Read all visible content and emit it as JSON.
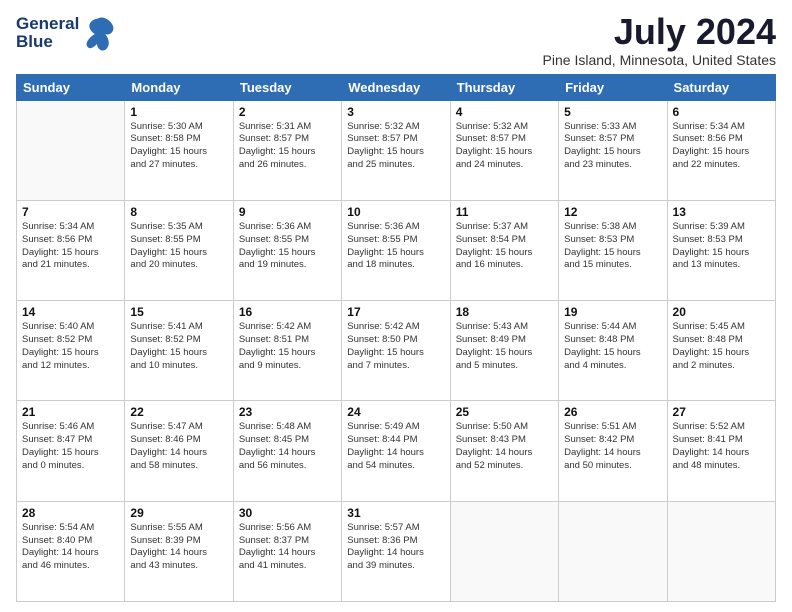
{
  "logo": {
    "line1": "General",
    "line2": "Blue"
  },
  "title": "July 2024",
  "subtitle": "Pine Island, Minnesota, United States",
  "days_of_week": [
    "Sunday",
    "Monday",
    "Tuesday",
    "Wednesday",
    "Thursday",
    "Friday",
    "Saturday"
  ],
  "weeks": [
    [
      {
        "day": "",
        "info": ""
      },
      {
        "day": "1",
        "info": "Sunrise: 5:30 AM\nSunset: 8:58 PM\nDaylight: 15 hours\nand 27 minutes."
      },
      {
        "day": "2",
        "info": "Sunrise: 5:31 AM\nSunset: 8:57 PM\nDaylight: 15 hours\nand 26 minutes."
      },
      {
        "day": "3",
        "info": "Sunrise: 5:32 AM\nSunset: 8:57 PM\nDaylight: 15 hours\nand 25 minutes."
      },
      {
        "day": "4",
        "info": "Sunrise: 5:32 AM\nSunset: 8:57 PM\nDaylight: 15 hours\nand 24 minutes."
      },
      {
        "day": "5",
        "info": "Sunrise: 5:33 AM\nSunset: 8:57 PM\nDaylight: 15 hours\nand 23 minutes."
      },
      {
        "day": "6",
        "info": "Sunrise: 5:34 AM\nSunset: 8:56 PM\nDaylight: 15 hours\nand 22 minutes."
      }
    ],
    [
      {
        "day": "7",
        "info": "Sunrise: 5:34 AM\nSunset: 8:56 PM\nDaylight: 15 hours\nand 21 minutes."
      },
      {
        "day": "8",
        "info": "Sunrise: 5:35 AM\nSunset: 8:55 PM\nDaylight: 15 hours\nand 20 minutes."
      },
      {
        "day": "9",
        "info": "Sunrise: 5:36 AM\nSunset: 8:55 PM\nDaylight: 15 hours\nand 19 minutes."
      },
      {
        "day": "10",
        "info": "Sunrise: 5:36 AM\nSunset: 8:55 PM\nDaylight: 15 hours\nand 18 minutes."
      },
      {
        "day": "11",
        "info": "Sunrise: 5:37 AM\nSunset: 8:54 PM\nDaylight: 15 hours\nand 16 minutes."
      },
      {
        "day": "12",
        "info": "Sunrise: 5:38 AM\nSunset: 8:53 PM\nDaylight: 15 hours\nand 15 minutes."
      },
      {
        "day": "13",
        "info": "Sunrise: 5:39 AM\nSunset: 8:53 PM\nDaylight: 15 hours\nand 13 minutes."
      }
    ],
    [
      {
        "day": "14",
        "info": "Sunrise: 5:40 AM\nSunset: 8:52 PM\nDaylight: 15 hours\nand 12 minutes."
      },
      {
        "day": "15",
        "info": "Sunrise: 5:41 AM\nSunset: 8:52 PM\nDaylight: 15 hours\nand 10 minutes."
      },
      {
        "day": "16",
        "info": "Sunrise: 5:42 AM\nSunset: 8:51 PM\nDaylight: 15 hours\nand 9 minutes."
      },
      {
        "day": "17",
        "info": "Sunrise: 5:42 AM\nSunset: 8:50 PM\nDaylight: 15 hours\nand 7 minutes."
      },
      {
        "day": "18",
        "info": "Sunrise: 5:43 AM\nSunset: 8:49 PM\nDaylight: 15 hours\nand 5 minutes."
      },
      {
        "day": "19",
        "info": "Sunrise: 5:44 AM\nSunset: 8:48 PM\nDaylight: 15 hours\nand 4 minutes."
      },
      {
        "day": "20",
        "info": "Sunrise: 5:45 AM\nSunset: 8:48 PM\nDaylight: 15 hours\nand 2 minutes."
      }
    ],
    [
      {
        "day": "21",
        "info": "Sunrise: 5:46 AM\nSunset: 8:47 PM\nDaylight: 15 hours\nand 0 minutes."
      },
      {
        "day": "22",
        "info": "Sunrise: 5:47 AM\nSunset: 8:46 PM\nDaylight: 14 hours\nand 58 minutes."
      },
      {
        "day": "23",
        "info": "Sunrise: 5:48 AM\nSunset: 8:45 PM\nDaylight: 14 hours\nand 56 minutes."
      },
      {
        "day": "24",
        "info": "Sunrise: 5:49 AM\nSunset: 8:44 PM\nDaylight: 14 hours\nand 54 minutes."
      },
      {
        "day": "25",
        "info": "Sunrise: 5:50 AM\nSunset: 8:43 PM\nDaylight: 14 hours\nand 52 minutes."
      },
      {
        "day": "26",
        "info": "Sunrise: 5:51 AM\nSunset: 8:42 PM\nDaylight: 14 hours\nand 50 minutes."
      },
      {
        "day": "27",
        "info": "Sunrise: 5:52 AM\nSunset: 8:41 PM\nDaylight: 14 hours\nand 48 minutes."
      }
    ],
    [
      {
        "day": "28",
        "info": "Sunrise: 5:54 AM\nSunset: 8:40 PM\nDaylight: 14 hours\nand 46 minutes."
      },
      {
        "day": "29",
        "info": "Sunrise: 5:55 AM\nSunset: 8:39 PM\nDaylight: 14 hours\nand 43 minutes."
      },
      {
        "day": "30",
        "info": "Sunrise: 5:56 AM\nSunset: 8:37 PM\nDaylight: 14 hours\nand 41 minutes."
      },
      {
        "day": "31",
        "info": "Sunrise: 5:57 AM\nSunset: 8:36 PM\nDaylight: 14 hours\nand 39 minutes."
      },
      {
        "day": "",
        "info": ""
      },
      {
        "day": "",
        "info": ""
      },
      {
        "day": "",
        "info": ""
      }
    ]
  ]
}
